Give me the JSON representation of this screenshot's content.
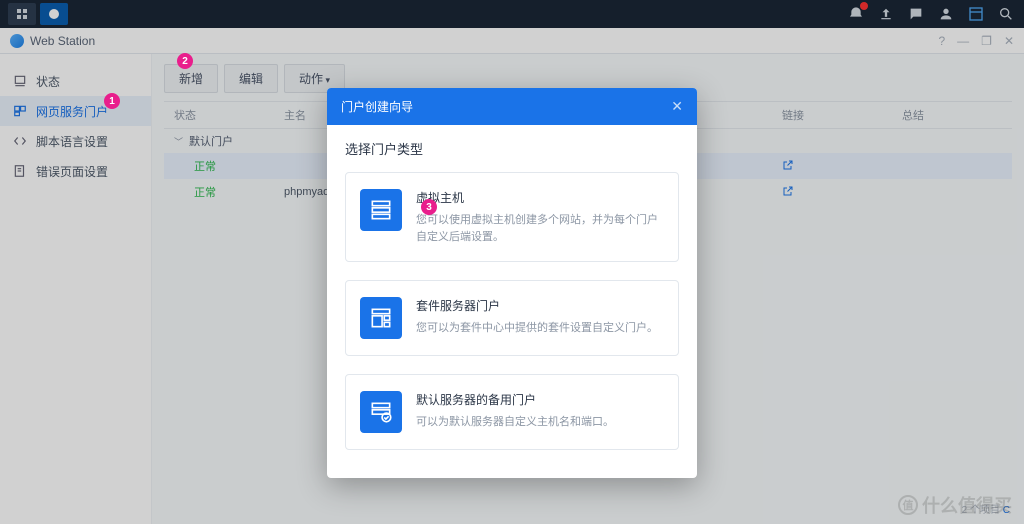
{
  "taskbar": {
    "right_icons": [
      "notification",
      "upload",
      "chat",
      "user",
      "browser",
      "search"
    ]
  },
  "window": {
    "title": "Web Station",
    "controls": [
      "?",
      "—",
      "⬜",
      "✕"
    ]
  },
  "sidebar": {
    "items": [
      {
        "label": "状态",
        "icon": "status"
      },
      {
        "label": "网页服务门户",
        "icon": "portal",
        "active": true
      },
      {
        "label": "脚本语言设置",
        "icon": "script"
      },
      {
        "label": "错误页面设置",
        "icon": "error"
      }
    ]
  },
  "toolbar": {
    "add": "新增",
    "edit": "编辑",
    "actions": "动作"
  },
  "table": {
    "columns": {
      "status": "状态",
      "name": "主名",
      "link": "链接",
      "end": "总结"
    },
    "section": "默认门户",
    "rows": [
      {
        "status": "正常",
        "name": "",
        "link": true,
        "selected": true
      },
      {
        "status": "正常",
        "name": "phpmyadmin",
        "link": true
      }
    ],
    "footer": "2 个项目"
  },
  "modal": {
    "title": "门户创建向导",
    "subtitle": "选择门户类型",
    "options": [
      {
        "title": "虚拟主机",
        "desc": "您可以使用虚拟主机创建多个网站，并为每个门户自定义后端设置。"
      },
      {
        "title": "套件服务器门户",
        "desc": "您可以为套件中心中提供的套件设置自定义门户。"
      },
      {
        "title": "默认服务器的备用门户",
        "desc": "可以为默认服务器自定义主机名和端口。"
      }
    ]
  },
  "annotations": {
    "1": "1",
    "2": "2",
    "3": "3"
  },
  "watermark": "什么值得买"
}
